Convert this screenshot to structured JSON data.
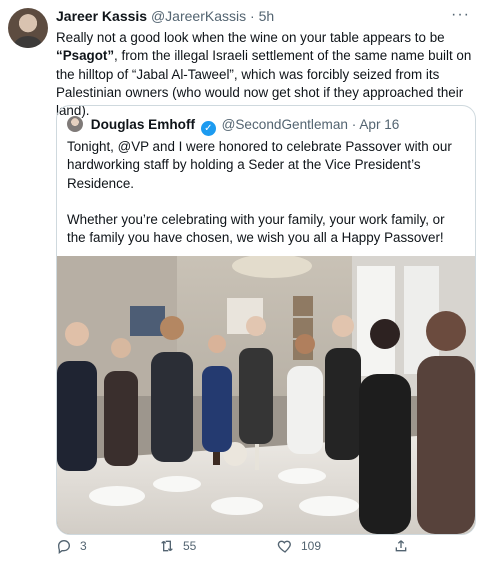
{
  "tweet": {
    "author_name": "Jareer Kassis",
    "author_handle": "@JareerKassis",
    "separator": "·",
    "time": "5h",
    "more_label": "···",
    "text_part1": "Really not a good look when the wine on your table appears to be ",
    "text_bold": "“Psagot”",
    "text_part2": ", from the illegal Israeli settlement of the same name built on the hilltop of “Jabal Al-Taweel”, which was forcibly seized from its Palestinian owners (who would now get shot if they approached their land).",
    "quoted": {
      "author_name": "Douglas Emhoff",
      "author_handle": "@SecondGentleman",
      "separator": "·",
      "time": "Apr 16",
      "verified_label": "✓",
      "text": "Tonight, @VP and I were honored to celebrate Passover with our hardworking staff by holding a Seder at the Vice President’s Residence.\n\nWhether you’re celebrating with your family, your work family, or the family you have chosen, we wish you all a Happy Passover!"
    },
    "actions": {
      "replies": "3",
      "retweets": "55",
      "likes": "109"
    }
  },
  "icons": {
    "reply": "reply-icon",
    "retweet": "retweet-icon",
    "like": "heart-icon",
    "share": "share-icon",
    "more": "more-icon"
  },
  "colors": {
    "text_primary": "#0f1419",
    "text_secondary": "#536471",
    "border": "#cfd9de",
    "verified": "#1d9bf0"
  }
}
